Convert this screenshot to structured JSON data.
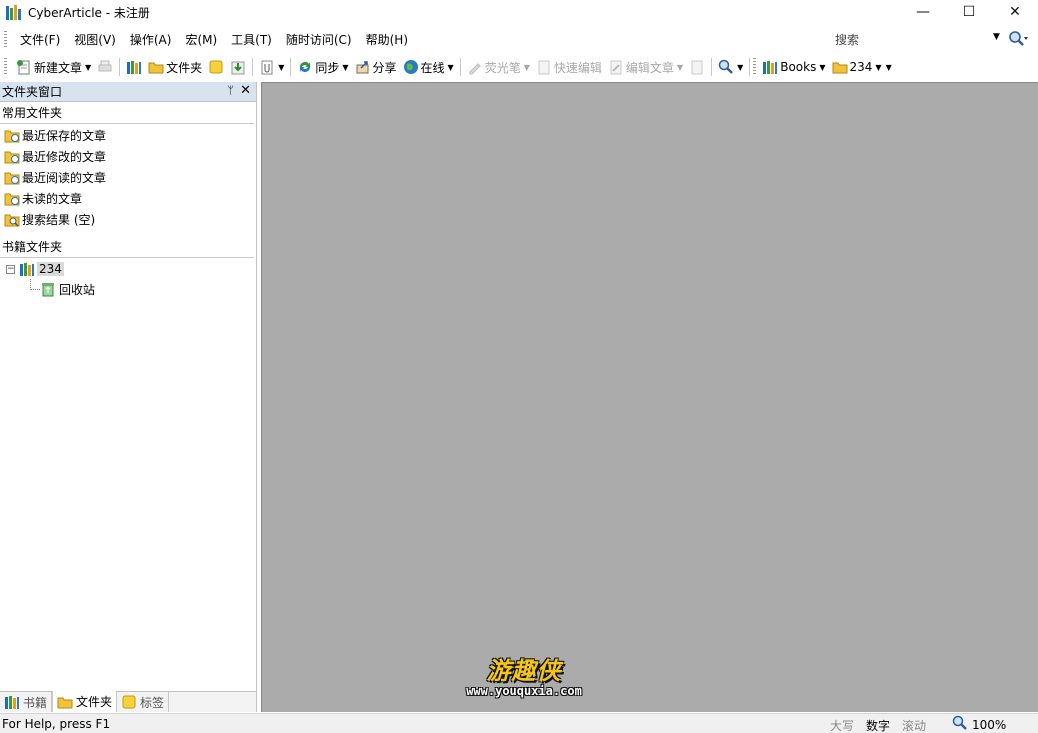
{
  "window": {
    "title": "CyberArticle - 未注册",
    "controls": {
      "minimize": "—",
      "maximize": "☐",
      "close": "✕"
    }
  },
  "menubar": {
    "items": [
      "文件(F)",
      "视图(V)",
      "操作(A)",
      "宏(M)",
      "工具(T)",
      "随时访问(C)",
      "帮助(H)"
    ],
    "search_label": "搜索"
  },
  "toolbar": {
    "new_article": "新建文章",
    "folder": "文件夹",
    "sync": "同步",
    "share": "分享",
    "online": "在线",
    "highlighter": "荧光笔",
    "quick_edit": "快速编辑",
    "edit_article": "编辑文章",
    "books": "Books",
    "current_folder": "234"
  },
  "leftpane": {
    "header": "文件夹窗口",
    "pin_glyph": "ᛘ",
    "close_glyph": "✕",
    "common_title": "常用文件夹",
    "common_items": [
      "最近保存的文章",
      "最近修改的文章",
      "最近阅读的文章",
      "未读的文章",
      "搜索结果 (空)"
    ],
    "books_title": "书籍文件夹",
    "tree": {
      "expander": "−",
      "root": "234",
      "child": "回收站"
    },
    "tabs": [
      "书籍",
      "文件夹",
      "标签"
    ]
  },
  "watermark": {
    "cn": "游趣侠",
    "url": "www.youquxia.com"
  },
  "statusbar": {
    "help": "For Help, press F1",
    "caps": "大写",
    "num": "数字",
    "scroll": "滚动",
    "zoom": "100%"
  },
  "colors": {
    "accent_header": "#d9e3f0",
    "main_bg": "#ababab",
    "folder_yellow": "#f2c23a",
    "watermark_gold": "#f5c518"
  }
}
